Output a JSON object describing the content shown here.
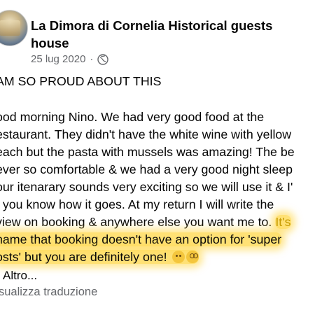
{
  "post": {
    "author": "La Dimora di Cornelia Historical guests house",
    "date": "25 lug 2020",
    "separator": "·",
    "privacy_icon": "globe-icon",
    "headline": "AM SO PROUD ABOUT THIS",
    "lines": [
      "ood morning Nino. We had very good food at the",
      "estaurant. They  didn't have the white wine with yellow",
      "each but the pasta with mussels was amazing! The be",
      " ever so comfortable & we had a very good night sleep",
      "our itenarary sounds very exciting so we will use it & I'",
      "t you know how it goes. At my return I will write the",
      "view on booking & anywhere else you want me to. "
    ],
    "highlight_start": "It's",
    "highlight_lines": [
      "hame that booking doesn't have an option for 'super",
      "osts' but you are definitely one! "
    ],
    "emojis": [
      "smiling-face-icon",
      "nerd-face-icon"
    ],
    "see_more": "Altro...",
    "see_translation": "sualizza traduzione"
  },
  "colors": {
    "highlight": "#ffd640",
    "secondary_text": "#65676b",
    "primary_text": "#050505"
  }
}
